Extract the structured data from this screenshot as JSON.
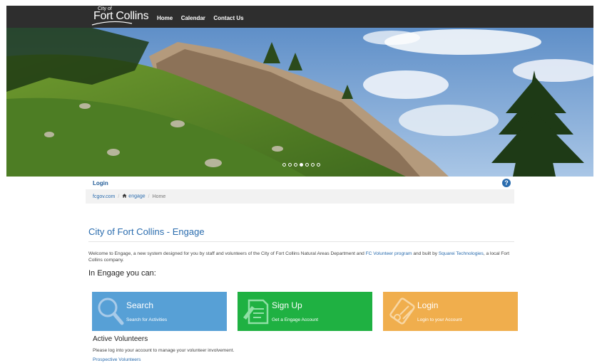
{
  "logo": {
    "small": "City of",
    "main": "Fort Collins"
  },
  "nav": {
    "items": [
      "Home",
      "Calendar",
      "Contact Us"
    ]
  },
  "hero": {
    "slides": 7,
    "active_slide": 4
  },
  "login_link": "Login",
  "help_icon": "?",
  "breadcrumb": {
    "home": "fcgov.com",
    "engage": "engage",
    "current": "Home",
    "separator": "/"
  },
  "page_title": "City of Fort Collins - Engage",
  "intro": {
    "part1": "Welcome to Engage, a new system designed for you by staff and volunteers of the City of Fort Collins Natural Areas Department and ",
    "link1": "FC Volunteer program",
    "part2": " and built by ",
    "link2": "Squarei Technologies",
    "part3": ", a local Fort Collins company."
  },
  "engage_heading": "In Engage you can:",
  "tiles": [
    {
      "title": "Search",
      "subtitle": "Search for Activities",
      "icon": "magnifier-icon",
      "color": "#57a0d6"
    },
    {
      "title": "Sign Up",
      "subtitle": "Get a Engage Account",
      "icon": "signup-form-icon",
      "color": "#1fb142"
    },
    {
      "title": "Login",
      "subtitle": "Login to your Account",
      "icon": "key-card-icon",
      "color": "#f0ae4d"
    }
  ],
  "active_volunteers": {
    "heading": "Active Volunteers",
    "text": "Please log into your account to manage your volunteer involvement."
  },
  "prospective_link": "Prospective Volunteers"
}
